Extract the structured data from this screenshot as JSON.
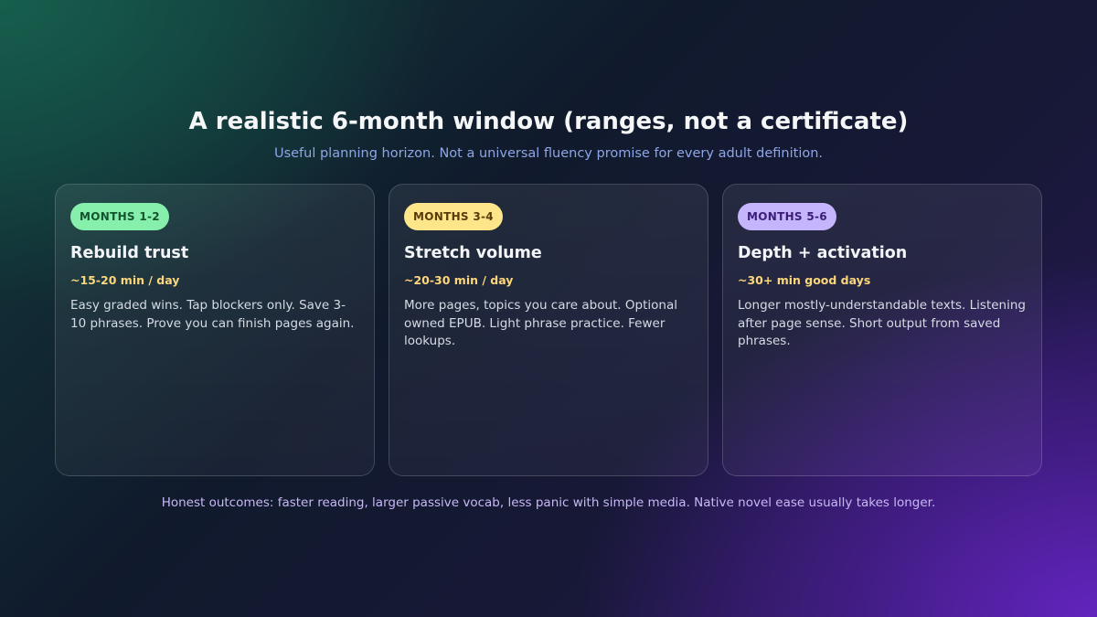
{
  "header": {
    "title": "A realistic 6-month window (ranges, not a certificate)",
    "subtitle": "Useful planning horizon. Not a universal fluency promise for every adult definition."
  },
  "cards": [
    {
      "badge": "MONTHS 1-2",
      "badge_color": "#86efac",
      "title": "Rebuild trust",
      "time": "~15-20 min / day",
      "description": "Easy graded wins. Tap blockers only. Save 3-10 phrases. Prove you can finish pages again."
    },
    {
      "badge": "MONTHS 3-4",
      "badge_color": "#fde68a",
      "title": "Stretch volume",
      "time": "~20-30 min / day",
      "description": "More pages, topics you care about. Optional owned EPUB. Light phrase practice. Fewer lookups."
    },
    {
      "badge": "MONTHS 5-6",
      "badge_color": "#c4b5fd",
      "title": "Depth + activation",
      "time": "~30+ min good days",
      "description": "Longer mostly-understandable texts. Listening after page sense. Short output from saved phrases."
    }
  ],
  "footer": {
    "note": "Honest outcomes: faster reading, larger passive vocab, less panic with simple media. Native novel ease usually takes longer."
  },
  "colors": {
    "time_accent": "#fcd67a",
    "subtitle": "#8fa6e6",
    "footer": "#c7b8f4"
  }
}
